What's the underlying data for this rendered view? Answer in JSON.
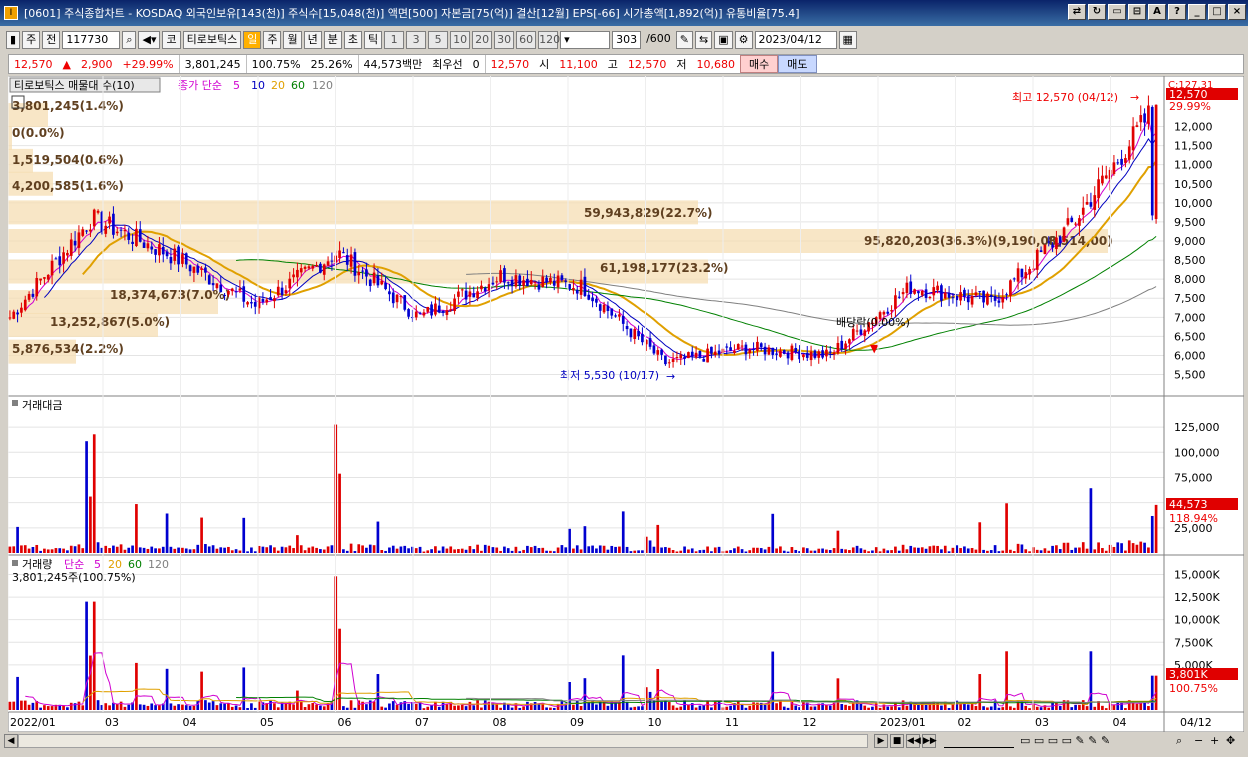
{
  "window": {
    "title": "[0601] 주식종합차트 - KOSDAQ 외국인보유[143(천)] 주식수[15,048(천)] 액면[500] 자본금[75(억)] 결산[12월] EPS[-66] 시가총액[1,892(억)] 유통비율[75.4]",
    "icon": "I"
  },
  "toolbar": {
    "market": "주",
    "prev": "전",
    "code": "117730",
    "kr_label": "코",
    "name": "티로보틱스",
    "periods": [
      "일",
      "주",
      "월",
      "년",
      "분",
      "초",
      "틱"
    ],
    "minutes": [
      "1",
      "3",
      "5",
      "10",
      "20",
      "30",
      "60",
      "120"
    ],
    "count": "303",
    "count_total": "/600",
    "date": "2023/04/12"
  },
  "quote": {
    "price": "12,570",
    "change": "2,900",
    "change_pct": "+29.99%",
    "volume": "3,801,245",
    "volume_ratio": "100.75%",
    "turnover": "25.26%",
    "amount": "44,573백만",
    "best_bid_label": "최우선",
    "best_bid": "0",
    "ask": "12,570",
    "open_label": "시",
    "open": "11,100",
    "high_label": "고",
    "high": "12,570",
    "low_label": "저",
    "low": "10,680",
    "buy_label": "매수",
    "sell_label": "매도"
  },
  "price_panel": {
    "tab": "티로보틱스 매물대 수(10)",
    "ma_label": "종가 단순",
    "ma_periods": [
      "5",
      "10",
      "20",
      "60",
      "120"
    ],
    "axis_top": "C:127.31",
    "current_price": "12,570",
    "current_pct": "29.99%",
    "y_ticks": [
      "12,000",
      "11,500",
      "11,000",
      "10,500",
      "10,000",
      "9,500",
      "9,000",
      "8,500",
      "8,000",
      "7,500",
      "7,000",
      "6,500",
      "6,000",
      "5,500"
    ],
    "high_note": "최고 12,570 (04/12)",
    "low_note": "최저 5,530 (10/17)",
    "dividend_note": "배당락(0.00%)",
    "volume_profile": [
      {
        "label": "3,801,245(1.4%)"
      },
      {
        "label": "0(0.0%)"
      },
      {
        "label": "1,519,504(0.6%)"
      },
      {
        "label": "4,200,585(1.6%)"
      },
      {
        "label": "59,943,829(22.7%)"
      },
      {
        "label": "95,820,203(36.3%)(9,190,00)"
      },
      {
        "label": "8,514,00)"
      },
      {
        "label": "61,198,177(23.2%)"
      },
      {
        "label": "18,374,673(7.0%)"
      },
      {
        "label": "13,252,867(5.0%)"
      },
      {
        "label": "5,876,534(2.2%)"
      }
    ]
  },
  "amount_panel": {
    "title": "거래대금",
    "y_ticks": [
      "125,000",
      "100,000",
      "75,000",
      "50,000",
      "25,000"
    ],
    "current": "44,573",
    "current_pct": "118.94%"
  },
  "volume_panel": {
    "title": "거래량",
    "ma_label": "단순",
    "ma_periods": [
      "5",
      "20",
      "60",
      "120"
    ],
    "summary": "3,801,245주(100.75%)",
    "y_ticks": [
      "15,000K",
      "12,500K",
      "10,000K",
      "7,500K",
      "5,000K"
    ],
    "current": "3,801K",
    "current_pct": "100.75%"
  },
  "x_axis": {
    "labels": [
      "2022/01",
      "03",
      "04",
      "05",
      "06",
      "07",
      "08",
      "09",
      "10",
      "11",
      "12",
      "2023/01",
      "02",
      "03",
      "04"
    ],
    "last_date": "04/12"
  },
  "colors": {
    "up": "#e00000",
    "down": "#0000d0",
    "ma5": "#d000d0",
    "ma10": "#0000c0",
    "ma20": "#e0a000",
    "ma60": "#008000",
    "ma120": "#808080",
    "profile": "#f5deb3"
  },
  "chart_data": {
    "type": "candlestick",
    "price_axis": [
      5500,
      12570
    ],
    "monthly_approx_close": [
      {
        "month": "2022/01",
        "close": 7000
      },
      {
        "month": "2022/03",
        "close": 9600
      },
      {
        "month": "2022/04",
        "close": 8600
      },
      {
        "month": "2022/05",
        "close": 7300
      },
      {
        "month": "2022/06",
        "close": 8700
      },
      {
        "month": "2022/07",
        "close": 7000
      },
      {
        "month": "2022/08",
        "close": 8100
      },
      {
        "month": "2022/09",
        "close": 7800
      },
      {
        "month": "2022/10",
        "close": 5800
      },
      {
        "month": "2022/11",
        "close": 6200
      },
      {
        "month": "2022/12",
        "close": 6000
      },
      {
        "month": "2023/01",
        "close": 7800
      },
      {
        "month": "2023/02",
        "close": 7400
      },
      {
        "month": "2023/03",
        "close": 9500
      },
      {
        "month": "2023/04",
        "close": 12570
      }
    ]
  }
}
